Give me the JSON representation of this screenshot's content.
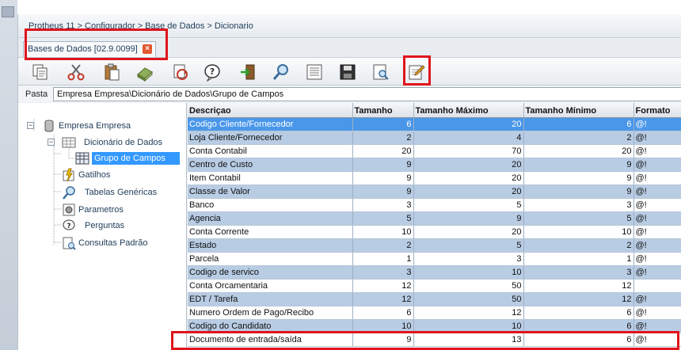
{
  "breadcrumb": "Protheus 11 > Configurador > Base de Dados > Dicionario",
  "tab": {
    "label": "Bases de Dados [02.9.0099]",
    "close": "×"
  },
  "toolbar": {
    "buttons": [
      "copy-icon",
      "cut-icon",
      "paste-icon",
      "eraser-icon",
      "sync-icon",
      "help-icon",
      "exit-icon",
      "search-icon",
      "list-icon",
      "save-icon",
      "preview-icon",
      "edit-icon"
    ]
  },
  "path": {
    "label": "Pasta",
    "value": "Empresa Empresa\\Dicionário de Dados\\Grupo de Campos"
  },
  "tree": {
    "items": [
      {
        "label": "Empresa Empresa"
      },
      {
        "label": "Dicionário de Dados"
      },
      {
        "label": "Grupo de Campos"
      },
      {
        "label": "Gatilhos"
      },
      {
        "label": "Tabelas Genéricas"
      },
      {
        "label": "Parametros"
      },
      {
        "label": "Perguntas"
      },
      {
        "label": "Consultas Padrão"
      }
    ]
  },
  "grid": {
    "headers": [
      "Descriçao",
      "Tamanho",
      "Tamanho Máximo",
      "Tamanho Mínimo",
      "Formato"
    ],
    "rows": [
      [
        "Codigo Cliente/Fornecedor",
        "6",
        "20",
        "6",
        "@!"
      ],
      [
        "Loja Cliente/Fornecedor",
        "2",
        "4",
        "2",
        "@!"
      ],
      [
        "Conta Contabil",
        "20",
        "70",
        "20",
        "@!"
      ],
      [
        "Centro de Custo",
        "9",
        "20",
        "9",
        "@!"
      ],
      [
        "Item Contabil",
        "9",
        "20",
        "9",
        "@!"
      ],
      [
        "Classe de Valor",
        "9",
        "20",
        "9",
        "@!"
      ],
      [
        "Banco",
        "3",
        "5",
        "3",
        "@!"
      ],
      [
        "Agencia",
        "5",
        "9",
        "5",
        "@!"
      ],
      [
        "Conta Corrente",
        "10",
        "20",
        "10",
        "@!"
      ],
      [
        "Estado",
        "2",
        "5",
        "2",
        "@!"
      ],
      [
        "Parcela",
        "1",
        "3",
        "1",
        "@!"
      ],
      [
        "Codigo de servico",
        "3",
        "10",
        "3",
        "@!"
      ],
      [
        "Conta Orcamentaria",
        "12",
        "50",
        "12",
        ""
      ],
      [
        "EDT / Tarefa",
        "12",
        "50",
        "12",
        "@!"
      ],
      [
        "Numero Ordem de Pago/Recibo",
        "6",
        "12",
        "6",
        "@!"
      ],
      [
        "Codigo do Candidato",
        "10",
        "10",
        "6",
        "@!"
      ],
      [
        "Documento de entrada/saída",
        "9",
        "13",
        "6",
        "@!"
      ]
    ]
  }
}
